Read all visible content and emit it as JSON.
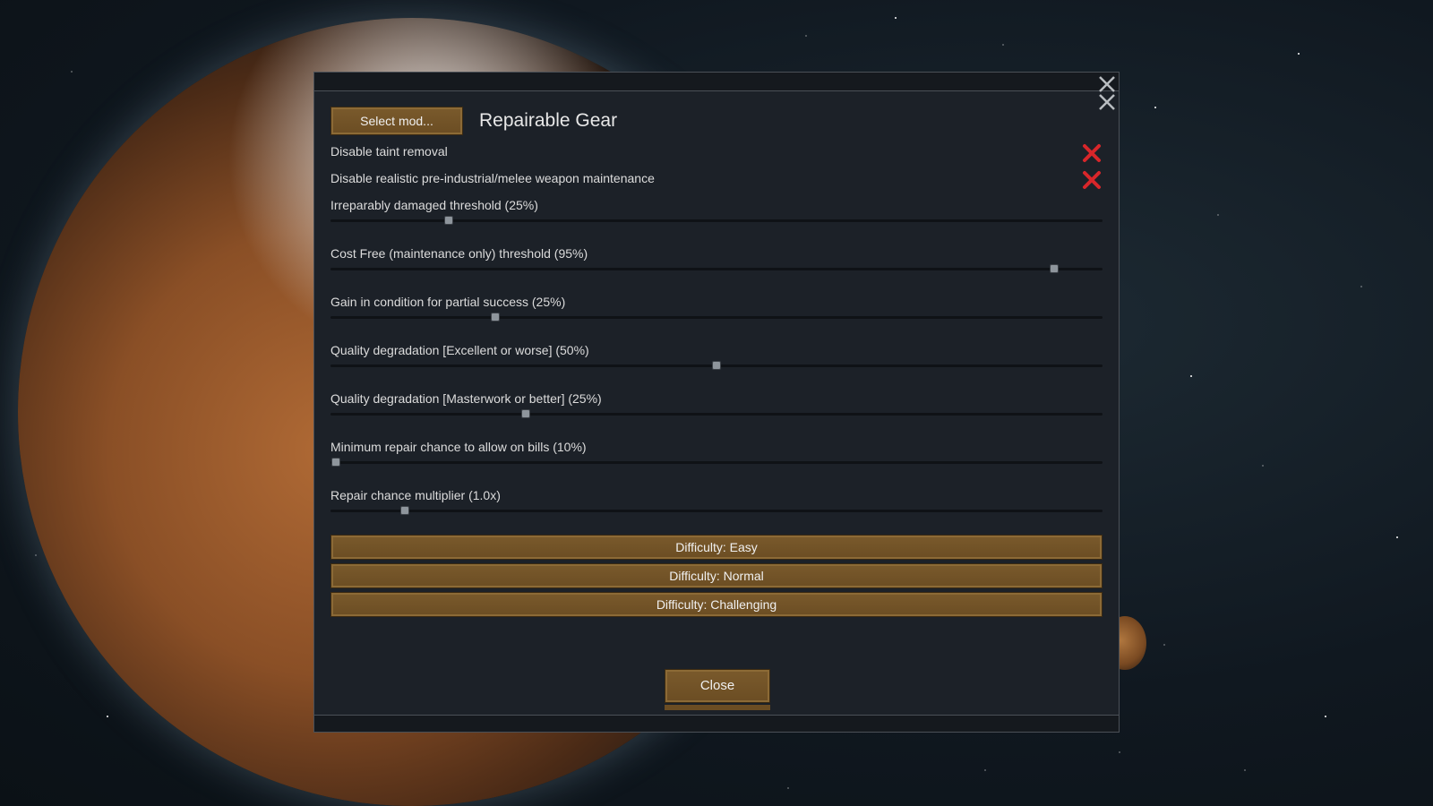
{
  "mod_settings": {
    "select_mod_label": "Select mod...",
    "mod_title": "Repairable Gear",
    "toggles": [
      {
        "label": "Disable taint removal",
        "enabled": false,
        "icon": "red-x-icon"
      },
      {
        "label": "Disable realistic pre-industrial/melee weapon maintenance",
        "enabled": false,
        "icon": "red-x-icon"
      }
    ],
    "sliders": [
      {
        "label": "Irreparably damaged threshold (25%)",
        "fraction": 0.153
      },
      {
        "label": "Cost Free (maintenance only) threshold (95%)",
        "fraction": 0.937
      },
      {
        "label": "Gain in condition for partial success (25%)",
        "fraction": 0.214
      },
      {
        "label": "Quality degradation [Excellent or worse] (50%)",
        "fraction": 0.5
      },
      {
        "label": "Quality degradation [Masterwork or better] (25%)",
        "fraction": 0.253
      },
      {
        "label": "Minimum repair chance to allow on bills (10%)",
        "fraction": 0.007
      },
      {
        "label": "Repair chance multiplier (1.0x)",
        "fraction": 0.096
      }
    ],
    "difficulty_buttons": [
      {
        "label": "Difficulty: Easy"
      },
      {
        "label": "Difficulty: Normal"
      },
      {
        "label": "Difficulty: Challenging"
      }
    ],
    "close_label": "Close"
  },
  "colors": {
    "dialog_bg": "#1c2128",
    "button_brown": "#6b4d23",
    "toggle_off_red": "#d8262a",
    "text": "#dcdcdc"
  }
}
